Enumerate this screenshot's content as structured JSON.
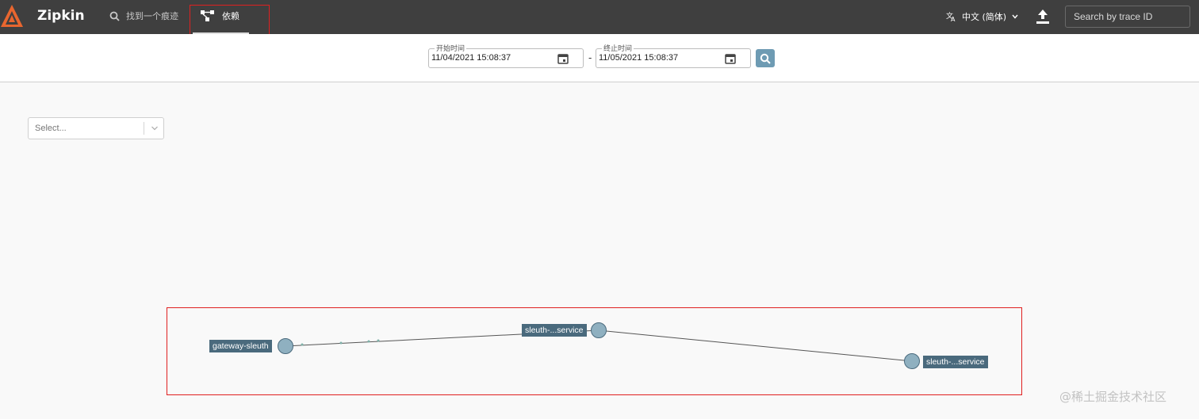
{
  "app": {
    "title": "Zipkin"
  },
  "nav": {
    "find_trace_label": "找到一个痕迹",
    "dependencies_label": "依赖"
  },
  "header": {
    "language_label": "中文 (简体)",
    "search_trace_placeholder": "Search by trace ID"
  },
  "date_range": {
    "start_label": "开始时间",
    "start_value": "11/04/2021 15:08:37",
    "separator": "-",
    "end_label": "终止时间",
    "end_value": "11/05/2021 15:08:37"
  },
  "filter": {
    "select_placeholder": "Select..."
  },
  "graph": {
    "nodes": [
      {
        "label": "gateway-sleuth"
      },
      {
        "label": "sleuth-...service"
      },
      {
        "label": "sleuth-...service"
      }
    ]
  },
  "watermark": "@稀土掘金技术社区",
  "colors": {
    "topbar": "#3f3f3f",
    "accent": "#6e9bb3",
    "node_fill": "#8fb0c0",
    "label_bg": "#4a6a7d",
    "highlight": "#e02020"
  }
}
